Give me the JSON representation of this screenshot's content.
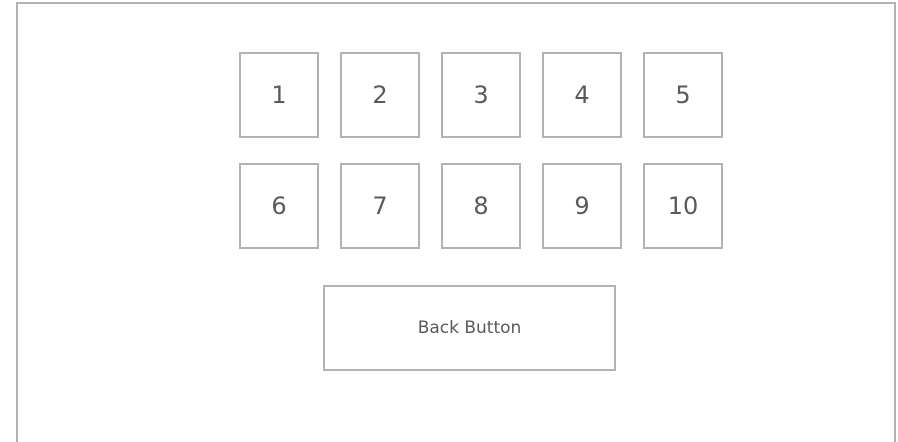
{
  "level_grid": {
    "row_1": [
      "1",
      "2",
      "3",
      "4",
      "5"
    ],
    "row_2": [
      "6",
      "7",
      "8",
      "9",
      "10"
    ]
  },
  "back_button_label": "Back Button"
}
